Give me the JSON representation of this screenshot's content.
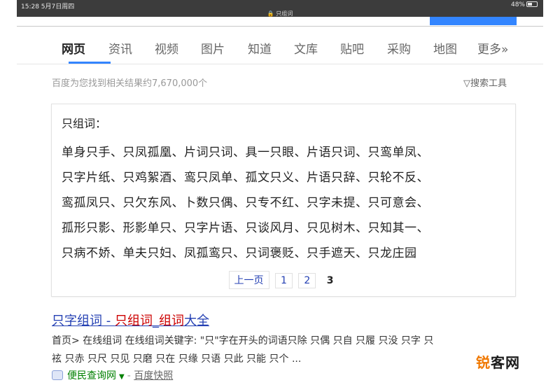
{
  "statusbar": {
    "time": "15:28  5月7日周四",
    "url": "🔒 只组词",
    "indicators": "48%"
  },
  "tabs": [
    {
      "label": "网页",
      "active": true
    },
    {
      "label": "资讯"
    },
    {
      "label": "视频"
    },
    {
      "label": "图片"
    },
    {
      "label": "知道"
    },
    {
      "label": "文库"
    },
    {
      "label": "贴吧"
    },
    {
      "label": "采购"
    },
    {
      "label": "地图"
    },
    {
      "label": "更多»"
    }
  ],
  "result_count": "百度为您找到相关结果约7,670,000个",
  "search_tools": "搜索工具",
  "card": {
    "title": "只组词：",
    "lines": [
      "单身只手、只凤孤凰、片词只词、具一只眼、片语只词、只鸾单凤、",
      "只字片纸、只鸡絮酒、鸾只凤单、孤文只义、片语只辞、只轮不反、",
      "鸾孤凤只、只欠东风、卜数只偶、只专不红、只字未提、只可意会、",
      "孤形只影、形影单只、只字片语、只谈风月、只见树木、只知其一、",
      "只病不娇、单夫只妇、凤孤鸾只、只词褒贬、只手遮天、只龙庄园"
    ],
    "pager": {
      "prev": "上一页",
      "pages": [
        "1",
        "2"
      ],
      "current": "3"
    }
  },
  "result": {
    "title_part1": "只字组词 - ",
    "title_hl1": "只组词",
    "title_part2": "_",
    "title_hl2": "组词",
    "title_part3": "大全",
    "snippet_line1": "首页> 在线组词 在线组词关键字: \"只\"字在开头的词语只除 只偶 只自 只履 只没 只字 只",
    "snippet_line2": "袨 只赤 只尺 只见 只磨 只在 只缘 只语 只此 只能 只个 ...",
    "source_name": "便民查询网",
    "source_sep": "-",
    "cache_label": "百度快照"
  },
  "watermark": {
    "part1": "锐",
    "part2": "客网"
  },
  "colors": {
    "link": "#2440b3",
    "highlight": "#cc0000",
    "source": "#008000",
    "accent": "#3385ff"
  }
}
